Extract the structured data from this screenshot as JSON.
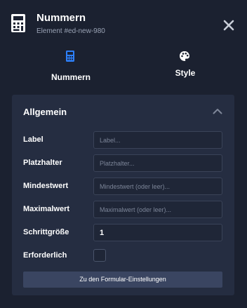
{
  "header": {
    "title": "Nummern",
    "subtitle": "Element #ed-new-980",
    "icon": "calculator-icon",
    "close_icon": "close-icon"
  },
  "tabs": [
    {
      "label": "Nummern",
      "icon": "calculator-icon",
      "active": true,
      "icon_color": "#2d7ff9"
    },
    {
      "label": "Style",
      "icon": "palette-icon",
      "active": false
    }
  ],
  "section": {
    "title": "Allgemein",
    "expanded": true,
    "fields": [
      {
        "label": "Label",
        "value": "",
        "placeholder": "Label..."
      },
      {
        "label": "Platzhalter",
        "value": "",
        "placeholder": "Platzhalter..."
      },
      {
        "label": "Mindestwert",
        "value": "",
        "placeholder": "Mindestwert (oder leer)..."
      },
      {
        "label": "Maximalwert",
        "value": "",
        "placeholder": "Maximalwert (oder leer)..."
      },
      {
        "label": "Schrittgröße",
        "value": "1",
        "placeholder": ""
      }
    ],
    "required": {
      "label": "Erforderlich",
      "checked": false
    },
    "button_label": "Zu den Formular-Einstellungen"
  },
  "colors": {
    "background": "#1b2130",
    "section": "#252d41",
    "accent": "#2d7ff9",
    "button": "#3a4561"
  }
}
